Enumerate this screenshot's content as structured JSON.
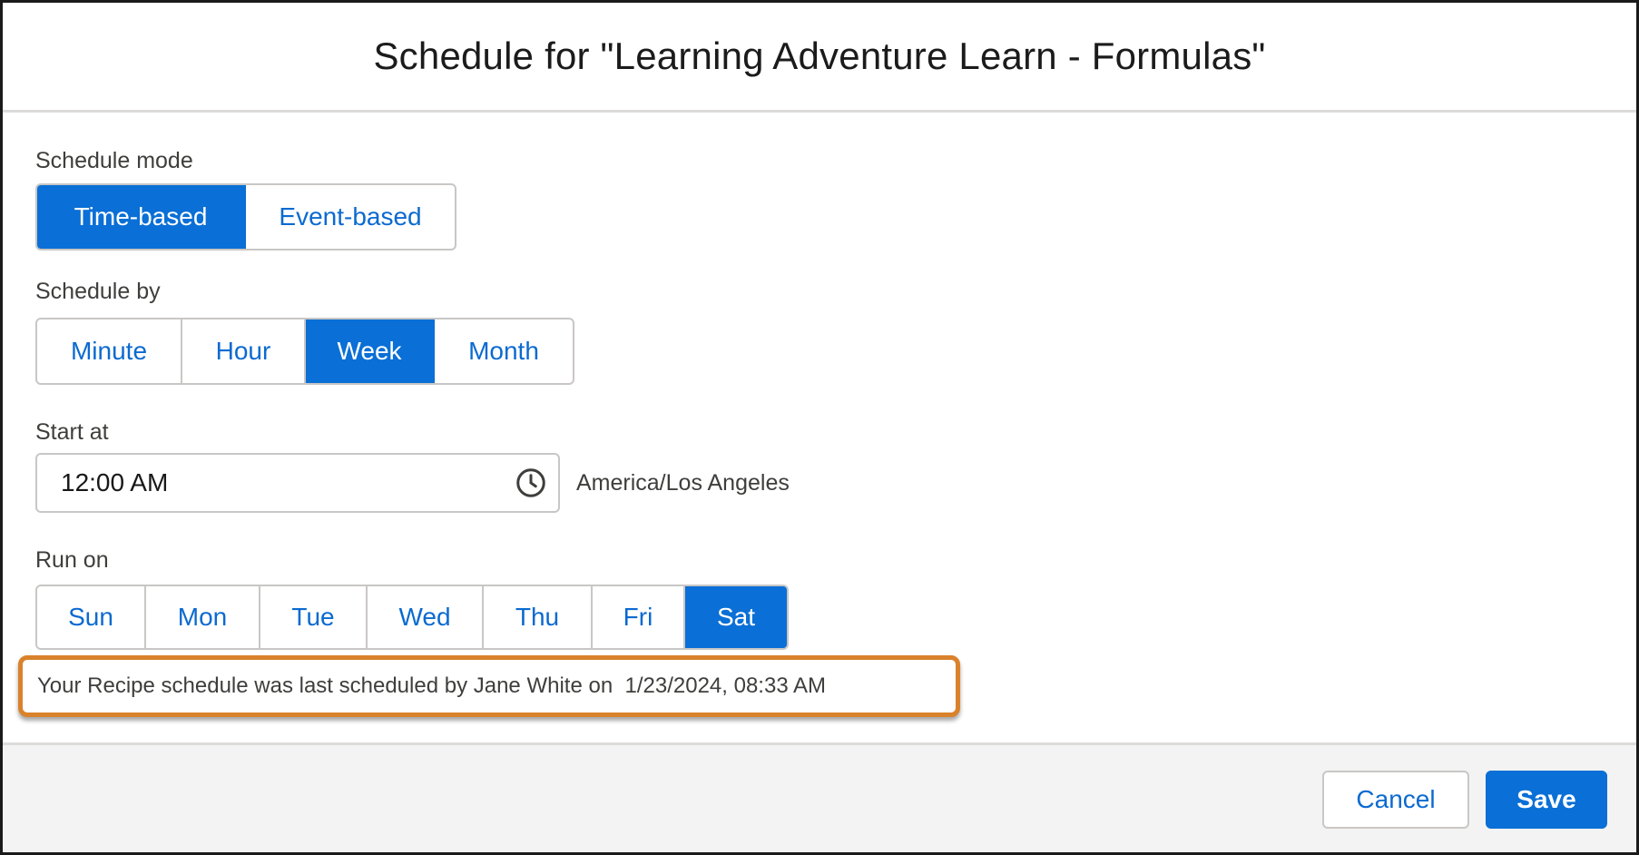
{
  "modal": {
    "title": "Schedule for \"Learning Adventure Learn - Formulas\""
  },
  "schedule_mode": {
    "label": "Schedule mode",
    "options": [
      "Time-based",
      "Event-based"
    ],
    "selected": "Time-based"
  },
  "schedule_by": {
    "label": "Schedule by",
    "options": [
      "Minute",
      "Hour",
      "Week",
      "Month"
    ],
    "selected": "Week"
  },
  "start_at": {
    "label": "Start at",
    "value": "12:00 AM",
    "timezone": "America/Los Angeles",
    "icon": "clock-icon"
  },
  "run_on": {
    "label": "Run on",
    "days": [
      "Sun",
      "Mon",
      "Tue",
      "Wed",
      "Thu",
      "Fri",
      "Sat"
    ],
    "selected": "Sat"
  },
  "last_scheduled": {
    "text": "Your Recipe schedule was last scheduled by Jane White on  1/23/2024, 08:33 AM"
  },
  "footer": {
    "cancel_label": "Cancel",
    "save_label": "Save"
  },
  "colors": {
    "brand_blue": "#0a6fd6",
    "highlight_orange": "#d9822b",
    "footer_bg": "#f3f3f3"
  }
}
